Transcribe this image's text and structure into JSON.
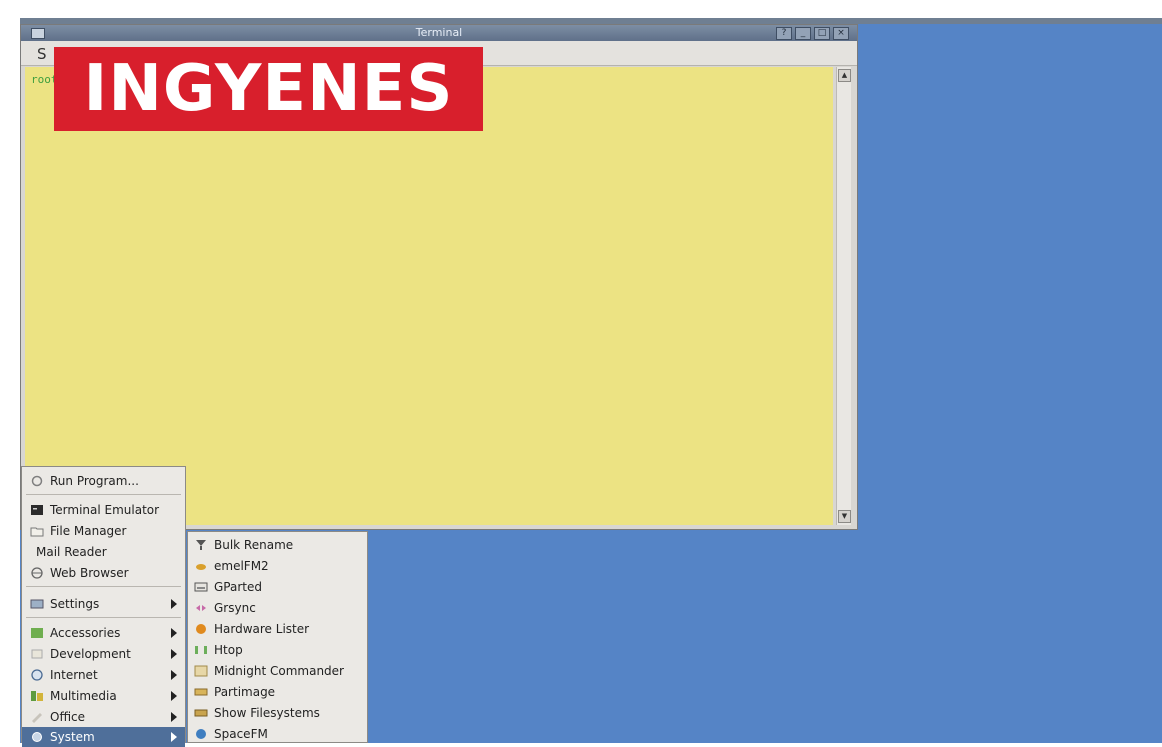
{
  "terminal": {
    "title": "Terminal",
    "menu_label": "S",
    "prompt": "root",
    "controls": [
      "?",
      "_",
      "□",
      "×"
    ]
  },
  "banner": {
    "text": "INGYENES"
  },
  "main_menu": {
    "items": [
      {
        "label": "Run Program...",
        "icon": "run-icon"
      },
      {
        "label": "Terminal Emulator",
        "icon": "terminal-icon"
      },
      {
        "label": "File Manager",
        "icon": "folder-icon"
      },
      {
        "label": "Mail Reader",
        "icon": ""
      },
      {
        "label": "Web Browser",
        "icon": "globe-icon"
      },
      {
        "label": "Settings",
        "icon": "settings-icon"
      },
      {
        "label": "Accessories",
        "icon": "accessories-icon"
      },
      {
        "label": "Development",
        "icon": "development-icon"
      },
      {
        "label": "Internet",
        "icon": "internet-icon"
      },
      {
        "label": "Multimedia",
        "icon": "multimedia-icon"
      },
      {
        "label": "Office",
        "icon": "office-icon"
      },
      {
        "label": "System",
        "icon": "system-icon"
      }
    ]
  },
  "sub_menu": {
    "items": [
      {
        "label": "Bulk Rename",
        "icon": "rename-icon"
      },
      {
        "label": "emelFM2",
        "icon": "file-manager-icon"
      },
      {
        "label": "GParted",
        "icon": "disk-icon"
      },
      {
        "label": "Grsync",
        "icon": "sync-icon"
      },
      {
        "label": "Hardware Lister",
        "icon": "hardware-icon"
      },
      {
        "label": "Htop",
        "icon": "htop-icon"
      },
      {
        "label": "Midnight Commander",
        "icon": "mc-icon"
      },
      {
        "label": "Partimage",
        "icon": "partimage-icon"
      },
      {
        "label": "Show Filesystems",
        "icon": "filesystems-icon"
      },
      {
        "label": "SpaceFM",
        "icon": "spacefm-icon"
      }
    ]
  },
  "colors": {
    "desktop": "#5584c6",
    "terminal_bg": "#ece383",
    "banner": "#d81f2c",
    "menu_selected": "#4f6f9a"
  }
}
